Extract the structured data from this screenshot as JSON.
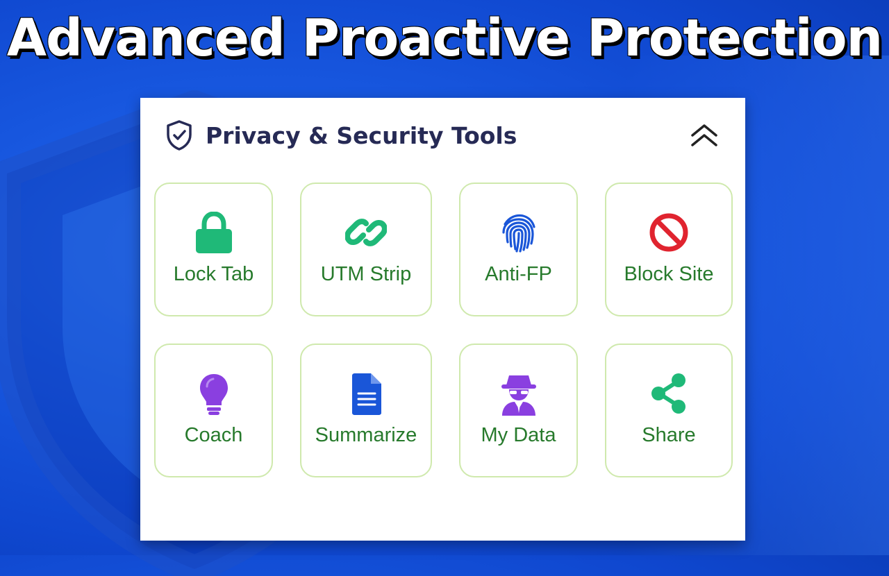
{
  "headline": "Advanced Proactive Protection",
  "panel": {
    "title": "Privacy & Security Tools",
    "tools": [
      {
        "label": "Lock Tab",
        "icon": "lock-icon",
        "color": "#1fb978"
      },
      {
        "label": "UTM Strip",
        "icon": "link-icon",
        "color": "#1fb978"
      },
      {
        "label": "Anti-FP",
        "icon": "fingerprint-icon",
        "color": "#1a56d8"
      },
      {
        "label": "Block Site",
        "icon": "block-icon",
        "color": "#e0242f"
      },
      {
        "label": "Coach",
        "icon": "lightbulb-icon",
        "color": "#8a3fe0"
      },
      {
        "label": "Summarize",
        "icon": "document-icon",
        "color": "#1a56d8"
      },
      {
        "label": "My Data",
        "icon": "spy-icon",
        "color": "#8a3fe0"
      },
      {
        "label": "Share",
        "icon": "share-icon",
        "color": "#1fb978"
      }
    ]
  },
  "colors": {
    "background": "#1858e0",
    "title_text": "#262a55",
    "tile_border": "#cfe9ad",
    "tile_label": "#277a2c"
  }
}
